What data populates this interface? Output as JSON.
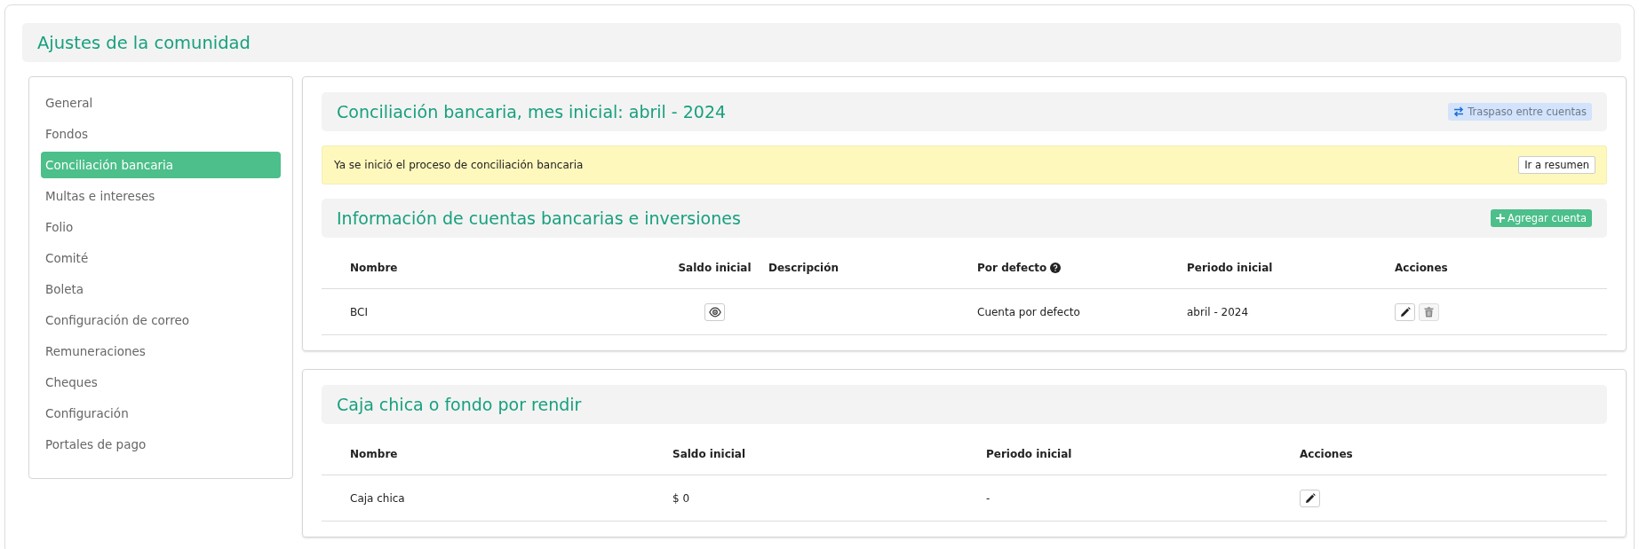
{
  "page": {
    "title": "Ajustes de la comunidad"
  },
  "sidebar": {
    "items": [
      {
        "label": "General",
        "selected": false
      },
      {
        "label": "Fondos",
        "selected": false
      },
      {
        "label": "Conciliación bancaria",
        "selected": true
      },
      {
        "label": "Multas e intereses",
        "selected": false
      },
      {
        "label": "Folio",
        "selected": false
      },
      {
        "label": "Comité",
        "selected": false
      },
      {
        "label": "Boleta",
        "selected": false
      },
      {
        "label": "Configuración de correo",
        "selected": false
      },
      {
        "label": "Remuneraciones",
        "selected": false
      },
      {
        "label": "Cheques",
        "selected": false
      },
      {
        "label": "Configuración",
        "selected": false
      },
      {
        "label": "Portales de pago",
        "selected": false
      }
    ]
  },
  "reconciliation": {
    "title": "Conciliación bancaria, mes inicial: abril - 2024",
    "transfer_button": "Traspaso entre cuentas",
    "alert": {
      "message": "Ya se inició el proceso de conciliación bancaria",
      "button": "Ir a resumen"
    },
    "accounts": {
      "title": "Información de cuentas bancarias e inversiones",
      "add_button": "Agregar cuenta",
      "columns": [
        {
          "label": "Nombre",
          "help": false
        },
        {
          "label": "Saldo inicial",
          "help": false
        },
        {
          "label": "Descripción",
          "help": false
        },
        {
          "label": "Por defecto",
          "help": true
        },
        {
          "label": "Periodo inicial",
          "help": false
        },
        {
          "label": "Acciones",
          "help": false
        }
      ],
      "rows": [
        {
          "cells": [
            {
              "kind": "text",
              "text": "BCI"
            },
            {
              "kind": "view"
            },
            {
              "kind": "empty"
            },
            {
              "kind": "text",
              "text": "Cuenta por defecto"
            },
            {
              "kind": "text",
              "text": "abril - 2024"
            },
            {
              "kind": "actions",
              "actions": [
                {
                  "kind": "edit",
                  "disabled": false
                },
                {
                  "kind": "delete",
                  "disabled": true
                }
              ]
            }
          ]
        }
      ]
    }
  },
  "petty_cash": {
    "title": "Caja chica o fondo por rendir",
    "columns": [
      {
        "label": "Nombre",
        "help": false
      },
      {
        "label": "Saldo inicial",
        "help": false
      },
      {
        "label": "Periodo inicial",
        "help": false
      },
      {
        "label": "Acciones",
        "help": false
      }
    ],
    "rows": [
      {
        "cells": [
          {
            "kind": "text",
            "text": "Caja chica"
          },
          {
            "kind": "text",
            "text": "$ 0"
          },
          {
            "kind": "text",
            "text": "-"
          },
          {
            "kind": "actions",
            "actions": [
              {
                "kind": "edit",
                "disabled": false
              }
            ]
          }
        ]
      }
    ]
  }
}
